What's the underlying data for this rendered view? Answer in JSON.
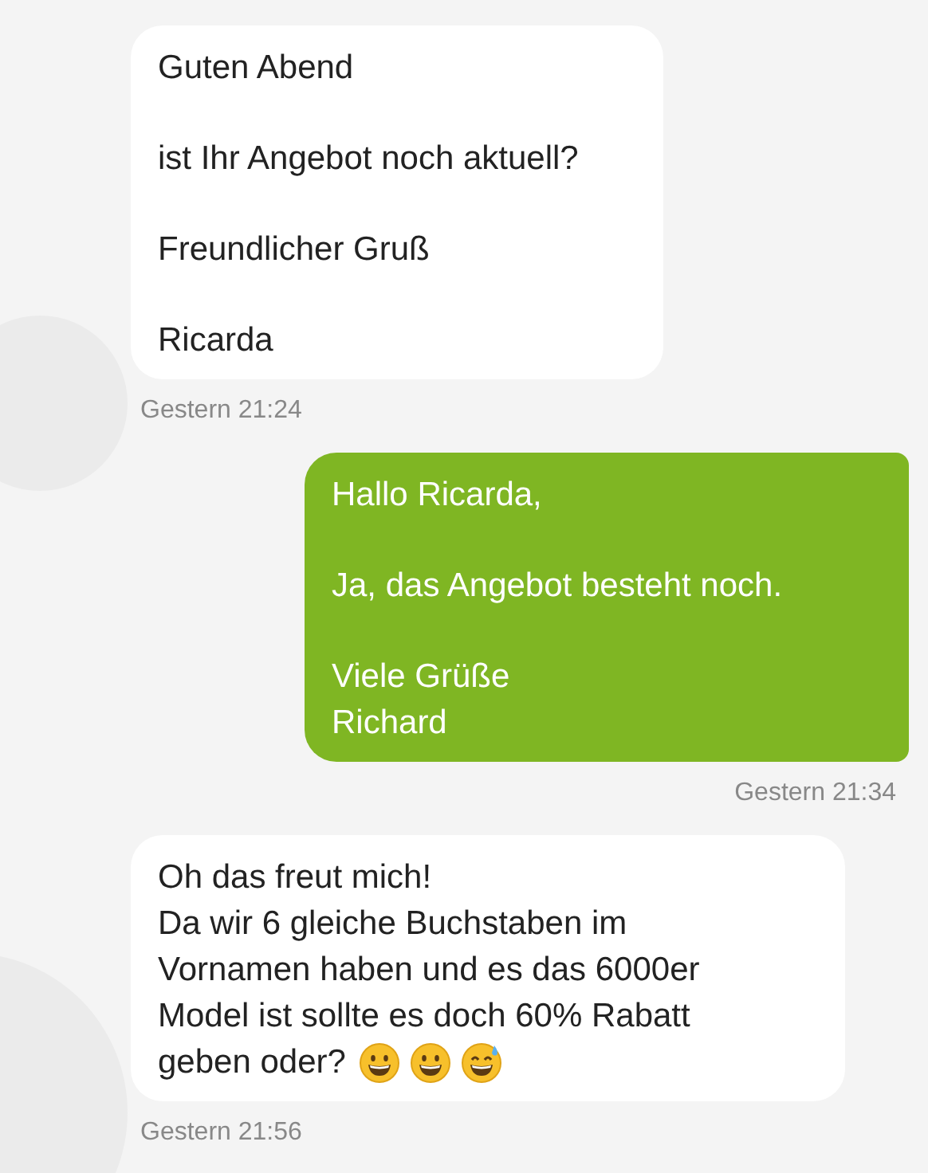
{
  "messages": [
    {
      "kind": "incoming",
      "paragraphs": [
        "Guten Abend",
        "ist Ihr Angebot noch aktuell?",
        "Freundlicher Gruß",
        "Ricarda"
      ],
      "time": "Gestern 21:24"
    },
    {
      "kind": "outgoing",
      "paragraphs": [
        "Hallo Ricarda,",
        "Ja, das Angebot besteht noch.",
        "Viele Grüße\nRichard"
      ],
      "time": "Gestern 21:34"
    },
    {
      "kind": "incoming",
      "paragraphs": [
        "Oh das freut mich!\nDa wir 6 gleiche Buchstaben im\nVornamen haben und es das 6000er\nModel ist sollte es doch 60% Rabatt\ngeben oder?"
      ],
      "emojis": [
        {
          "kind": "grin"
        },
        {
          "kind": "grin"
        },
        {
          "kind": "sweat"
        }
      ],
      "time": "Gestern 21:56"
    }
  ]
}
